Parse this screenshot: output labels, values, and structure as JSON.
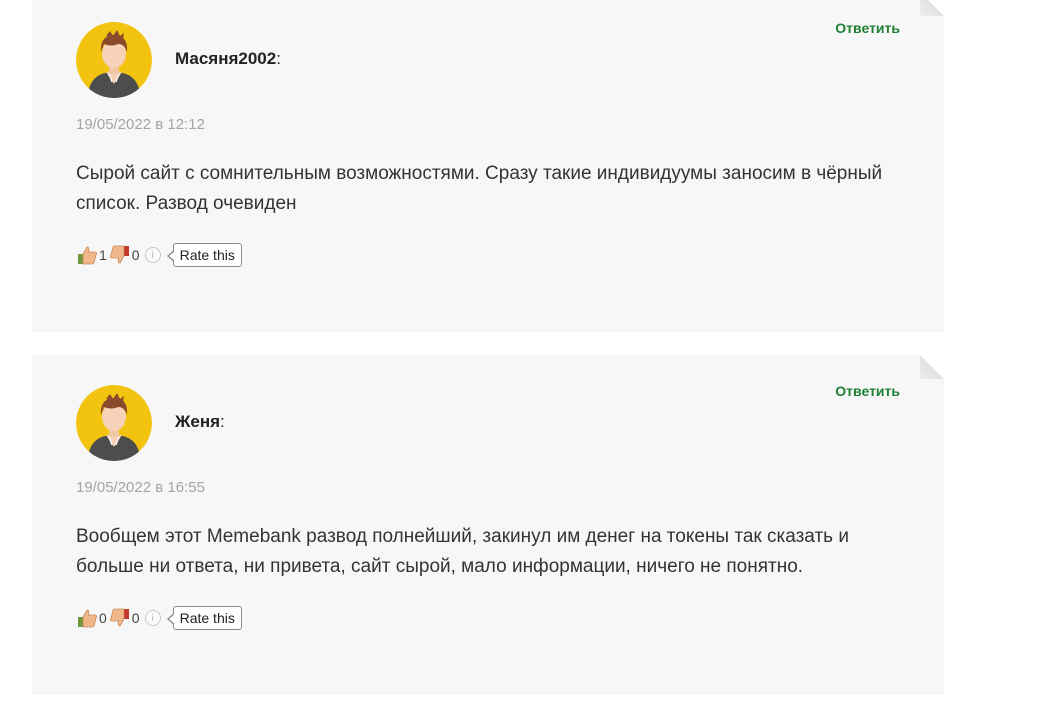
{
  "colors": {
    "card_background": "#f7f7f7",
    "reply_link": "#1e7e34",
    "date_text": "#a4a4a4",
    "avatar_background": "#f2c40f"
  },
  "comments": [
    {
      "author": "Масяня2002",
      "separator": ":",
      "reply_label": "Ответить",
      "date": "19/05/2022 в 12:12",
      "text": "Сырой сайт с сомнительным возможностями. Сразу такие индивидуумы заносим в чёрный список. Развод очевиден",
      "likes": "1",
      "dislikes": "0",
      "info_icon": "info-icon",
      "rate_label": "Rate this"
    },
    {
      "author": "Женя",
      "separator": ":",
      "reply_label": "Ответить",
      "date": "19/05/2022 в 16:55",
      "text": "Вообщем этот Memebank развод полнейший, закинул им денег на токены так сказать и больше ни ответа, ни привета, сайт сырой, мало информации, ничего не понятно.",
      "likes": "0",
      "dislikes": "0",
      "info_icon": "info-icon",
      "rate_label": "Rate this"
    }
  ]
}
